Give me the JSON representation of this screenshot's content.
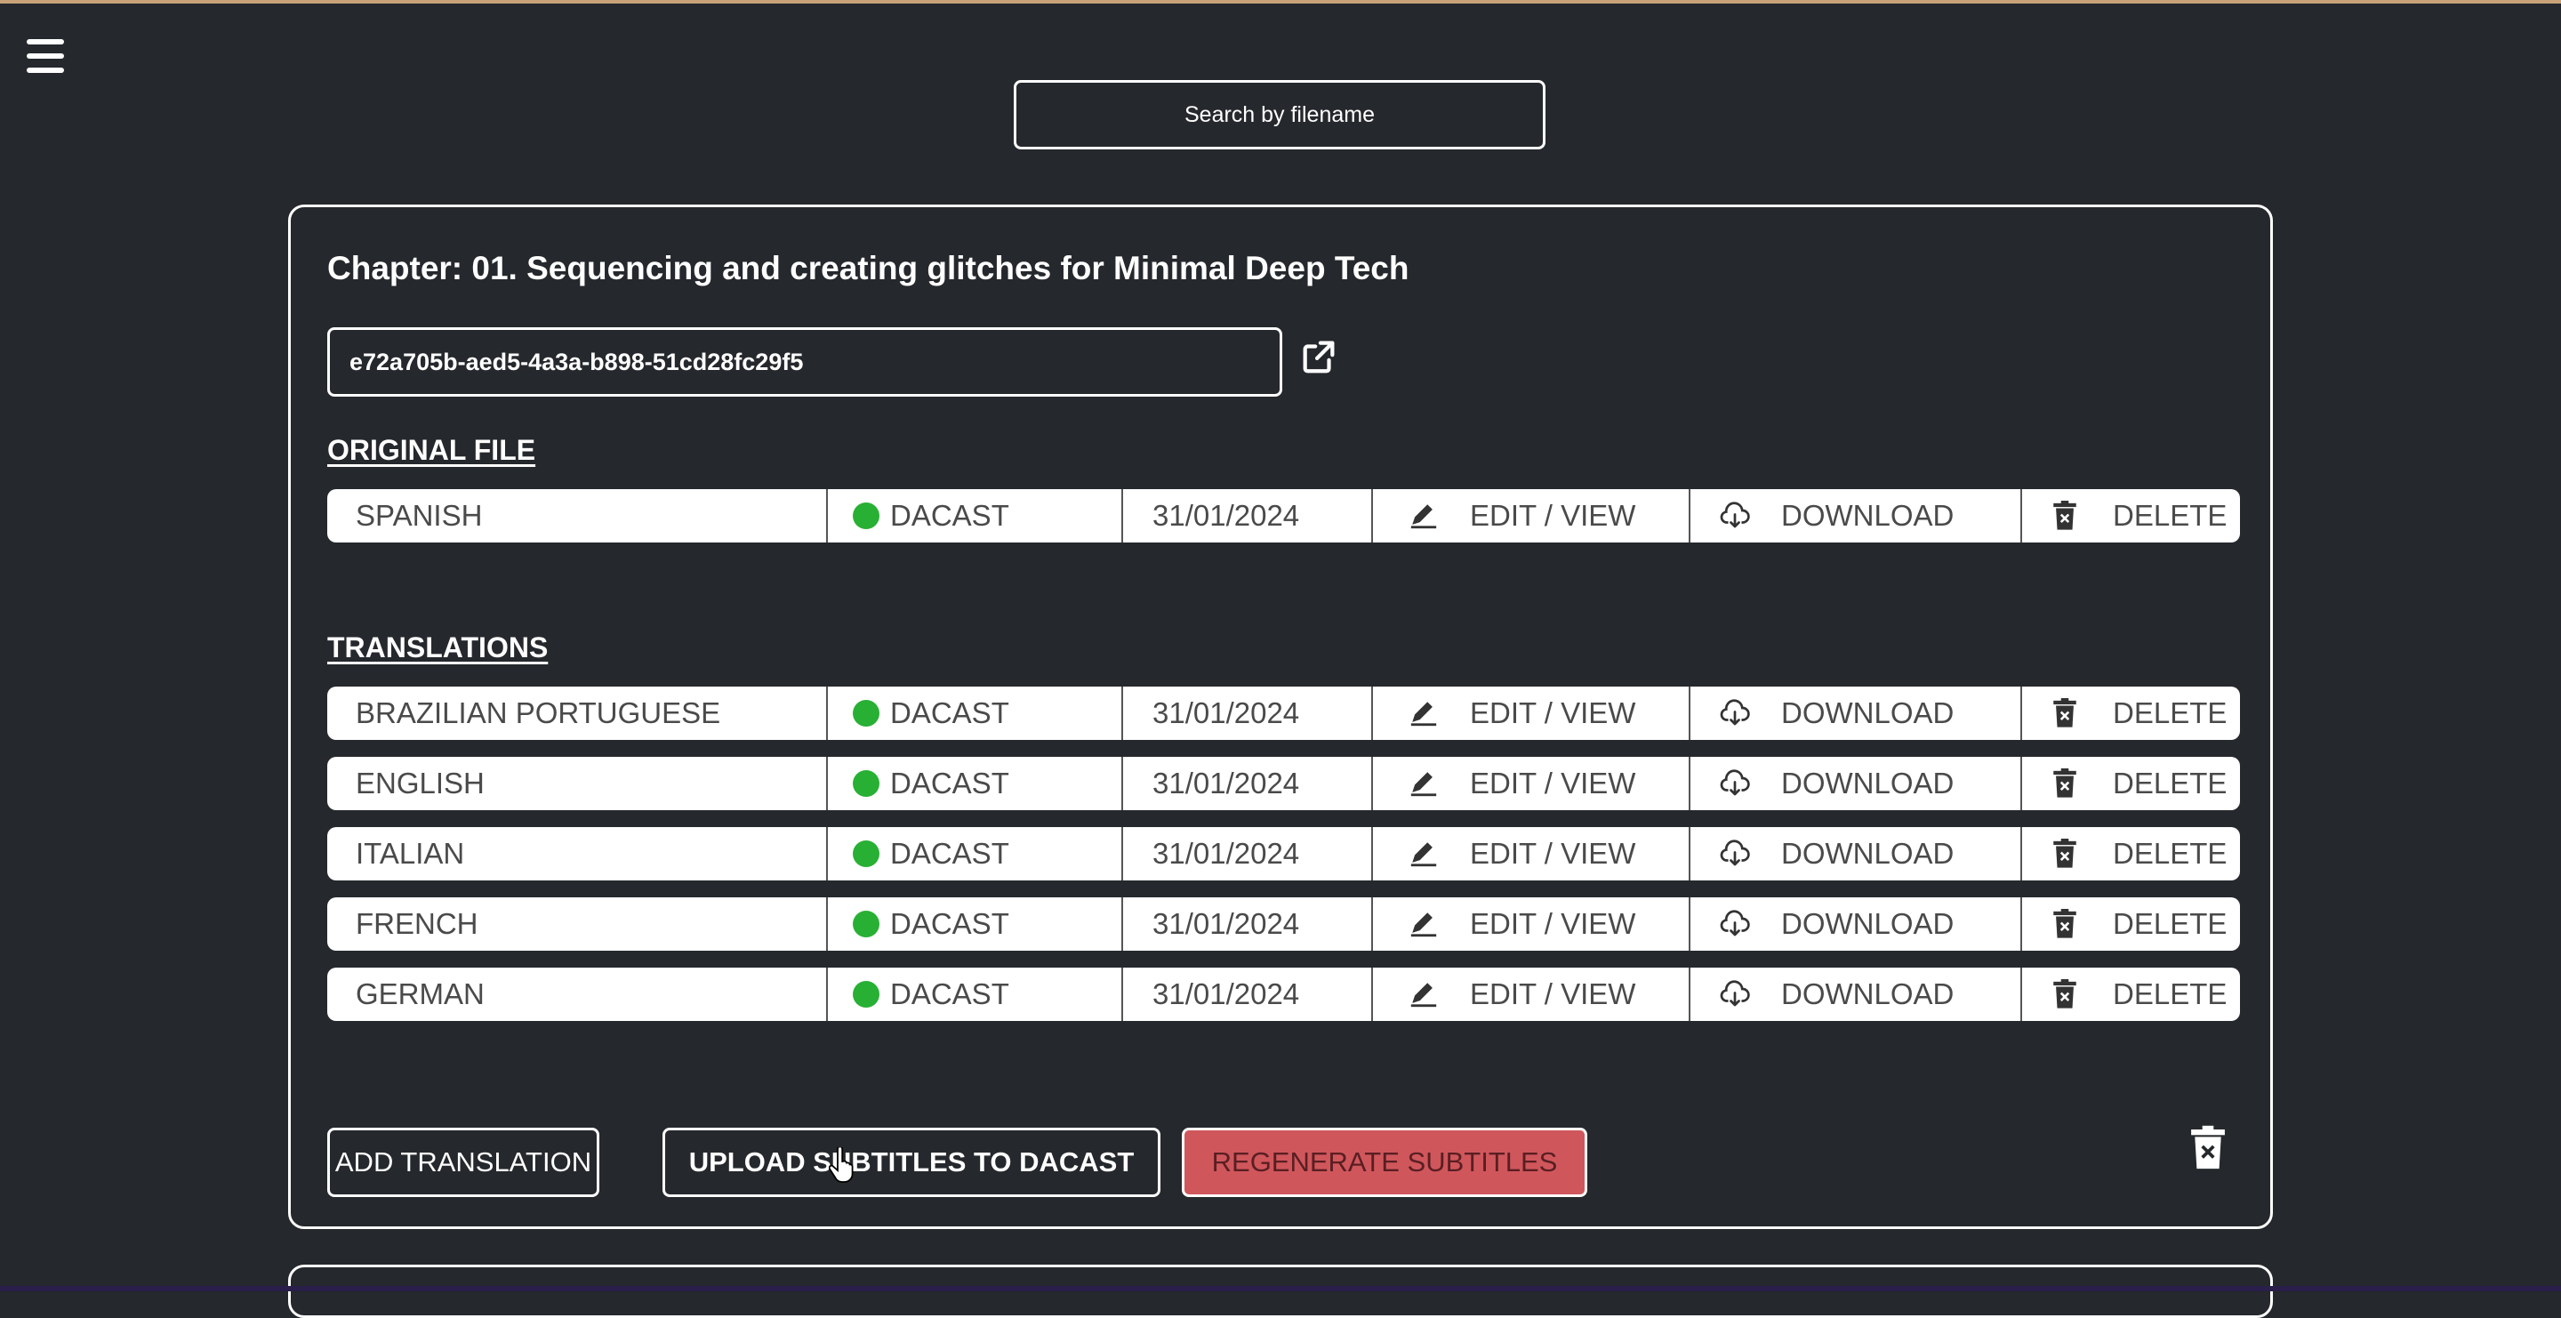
{
  "search": {
    "placeholder": "Search by filename"
  },
  "chapter": {
    "title": "Chapter: 01. Sequencing and creating glitches for Minimal Deep Tech",
    "id": "e72a705b-aed5-4a3a-b898-51cd28fc29f5"
  },
  "sections": {
    "original": "ORIGINAL FILE",
    "translations": "TRANSLATIONS"
  },
  "original_file": {
    "language": "SPANISH",
    "status": "DACAST",
    "date": "31/01/2024",
    "edit_label": "EDIT / VIEW",
    "download_label": "DOWNLOAD",
    "delete_label": "DELETE"
  },
  "translations": [
    {
      "language": "BRAZILIAN PORTUGUESE",
      "status": "DACAST",
      "date": "31/01/2024",
      "edit_label": "EDIT / VIEW",
      "download_label": "DOWNLOAD",
      "delete_label": "DELETE"
    },
    {
      "language": "ENGLISH",
      "status": "DACAST",
      "date": "31/01/2024",
      "edit_label": "EDIT / VIEW",
      "download_label": "DOWNLOAD",
      "delete_label": "DELETE"
    },
    {
      "language": "ITALIAN",
      "status": "DACAST",
      "date": "31/01/2024",
      "edit_label": "EDIT / VIEW",
      "download_label": "DOWNLOAD",
      "delete_label": "DELETE"
    },
    {
      "language": "FRENCH",
      "status": "DACAST",
      "date": "31/01/2024",
      "edit_label": "EDIT / VIEW",
      "download_label": "DOWNLOAD",
      "delete_label": "DELETE"
    },
    {
      "language": "GERMAN",
      "status": "DACAST",
      "date": "31/01/2024",
      "edit_label": "EDIT / VIEW",
      "download_label": "DOWNLOAD",
      "delete_label": "DELETE"
    }
  ],
  "actions": {
    "add_translation": "ADD TRANSLATION",
    "upload_subtitles": "UPLOAD SUBTITLES TO DACAST",
    "regenerate_subtitles": "REGENERATE SUBTITLES"
  },
  "colors": {
    "background": "#25282c",
    "status_green": "#28b034",
    "regenerate_red": "#cf575c"
  },
  "icons": {
    "menu": "hamburger-menu-icon",
    "external": "external-link-icon",
    "edit": "pencil-icon",
    "download": "cloud-download-icon",
    "delete": "trash-icon"
  }
}
